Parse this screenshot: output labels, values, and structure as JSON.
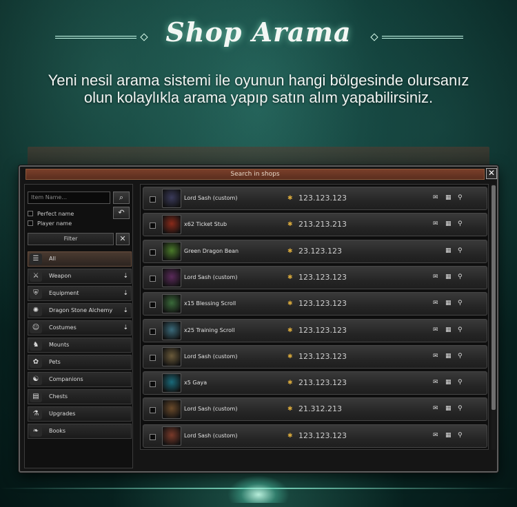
{
  "header": {
    "title": "Shop Arama",
    "subtitle_line1": "Yeni nesil arama sistemi ile oyunun hangi bölgesinde olursanız",
    "subtitle_line2": "olun kolaylıkla arama yapıp satın alım yapabilirsiniz."
  },
  "window": {
    "title": "Search in shops",
    "close_label": "✕"
  },
  "sidebar": {
    "search_placeholder": "Item Name...",
    "search_icon": "search-icon",
    "back_icon": "back-icon",
    "perfect_name_label": "Perfect name",
    "player_name_label": "Player name",
    "filter_label": "Filter",
    "clear_label": "✕",
    "categories": [
      {
        "label": "All",
        "icon": "list-icon",
        "glyph": "☰",
        "has_submenu": false,
        "active": true
      },
      {
        "label": "Weapon",
        "icon": "sword-icon",
        "glyph": "⚔",
        "has_submenu": true,
        "active": false
      },
      {
        "label": "Equipment",
        "icon": "armor-icon",
        "glyph": "⛨",
        "has_submenu": true,
        "active": false
      },
      {
        "label": "Dragon Stone Alchemy",
        "icon": "dragon-stone-icon",
        "glyph": "✺",
        "has_submenu": true,
        "active": false
      },
      {
        "label": "Costumes",
        "icon": "mask-icon",
        "glyph": "☺",
        "has_submenu": true,
        "active": false
      },
      {
        "label": "Mounts",
        "icon": "horse-icon",
        "glyph": "♞",
        "has_submenu": false,
        "active": false
      },
      {
        "label": "Pets",
        "icon": "paw-icon",
        "glyph": "✿",
        "has_submenu": false,
        "active": false
      },
      {
        "label": "Companions",
        "icon": "companion-icon",
        "glyph": "☯",
        "has_submenu": false,
        "active": false
      },
      {
        "label": "Chests",
        "icon": "chest-icon",
        "glyph": "▤",
        "has_submenu": false,
        "active": false
      },
      {
        "label": "Upgrades",
        "icon": "flask-icon",
        "glyph": "⚗",
        "has_submenu": false,
        "active": false
      },
      {
        "label": "Books",
        "icon": "book-icon",
        "glyph": "❧",
        "has_submenu": false,
        "active": false
      }
    ]
  },
  "results": [
    {
      "name": "Lord Sash (custom)",
      "price": "123.123.123",
      "icon": "lord-sash-icon",
      "color": "#3a3a5a",
      "actions": [
        "mail",
        "shop",
        "search"
      ]
    },
    {
      "name": "x62 Ticket Stub",
      "price": "213.213.213",
      "icon": "ticket-stub-icon",
      "color": "#8a2a1a",
      "actions": [
        "mail",
        "shop",
        "search"
      ]
    },
    {
      "name": "Green Dragon Bean",
      "price": "23.123.123",
      "icon": "green-bean-icon",
      "color": "#4a7a2a",
      "actions": [
        "shop",
        "search"
      ]
    },
    {
      "name": "Lord Sash (custom)",
      "price": "123.123.123",
      "icon": "lord-sash-icon",
      "color": "#5a2a5a",
      "actions": [
        "mail",
        "shop",
        "search"
      ]
    },
    {
      "name": "x15 Blessing Scroll",
      "price": "123.123.123",
      "icon": "blessing-scroll-icon",
      "color": "#3a6a3a",
      "actions": [
        "mail",
        "shop",
        "search"
      ]
    },
    {
      "name": "x25 Training Scroll",
      "price": "123.123.123",
      "icon": "training-scroll-icon",
      "color": "#3a6a7a",
      "actions": [
        "mail",
        "shop",
        "search"
      ]
    },
    {
      "name": "Lord Sash (custom)",
      "price": "123.123.123",
      "icon": "lord-sash-icon",
      "color": "#6a5a3a",
      "actions": [
        "mail",
        "shop",
        "search"
      ]
    },
    {
      "name": "x5 Gaya",
      "price": "213.123.123",
      "icon": "gaya-icon",
      "color": "#1a6a7a",
      "actions": [
        "mail",
        "shop",
        "search"
      ]
    },
    {
      "name": "Lord Sash (custom)",
      "price": "21.312.213",
      "icon": "lord-sash-icon",
      "color": "#6a4a2a",
      "actions": [
        "mail",
        "shop",
        "search"
      ]
    },
    {
      "name": "Lord Sash (custom)",
      "price": "123.123.123",
      "icon": "lord-sash-icon",
      "color": "#7a3a2a",
      "actions": [
        "mail",
        "shop",
        "search"
      ]
    }
  ]
}
